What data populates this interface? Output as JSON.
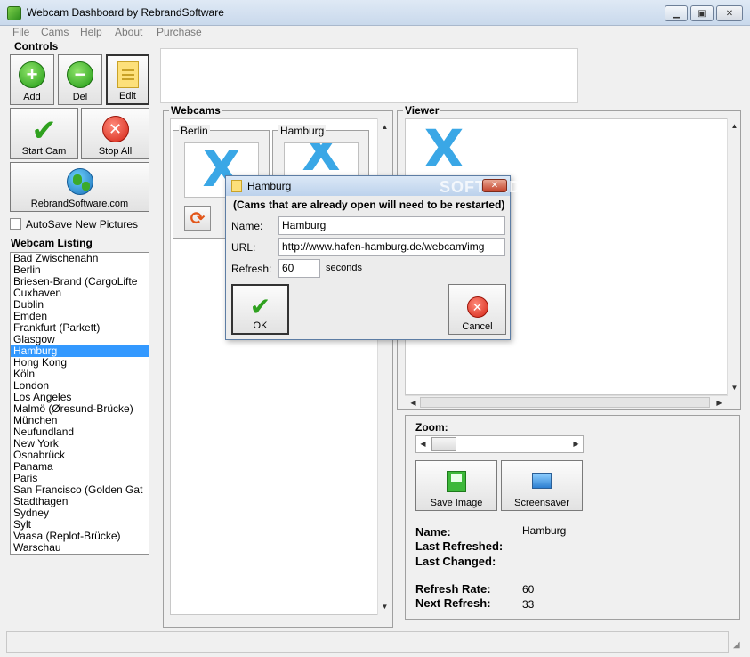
{
  "window": {
    "title": "Webcam Dashboard by RebrandSoftware",
    "minimize_icon": "minimize-icon",
    "maximize_icon": "maximize-icon",
    "close_icon": "close-icon"
  },
  "menu": [
    "File",
    "Cams",
    "Help",
    "About",
    "Purchase"
  ],
  "controls": {
    "title": "Controls",
    "add_label": "Add",
    "del_label": "Del",
    "edit_label": "Edit",
    "start_cam_label": "Start Cam",
    "stop_all_label": "Stop All",
    "website_label": "RebrandSoftware.com",
    "autosave_label": "AutoSave New Pictures",
    "autosave_checked": false
  },
  "listing": {
    "title": "Webcam Listing",
    "selected": "Hamburg",
    "items": [
      "Bad Zwischenahn",
      "Berlin",
      "Briesen-Brand (CargoLifte",
      "Cuxhaven",
      "Dublin",
      "Emden",
      "Frankfurt (Parkett)",
      "Glasgow",
      "Hamburg",
      "Hong Kong",
      "Köln",
      "London",
      "Los Angeles",
      "Malmö (Øresund-Brücke)",
      "München",
      "Neufundland",
      "New York",
      "Osnabrück",
      "Panama",
      "Paris",
      "San Francisco (Golden Gat",
      "Stadthagen",
      "Sydney",
      "Sylt",
      "Vaasa (Replot-Brücke)",
      "Warschau"
    ]
  },
  "webcams": {
    "title": "Webcams",
    "cams": [
      {
        "name": "Berlin"
      },
      {
        "name": "Hamburg"
      }
    ]
  },
  "viewer": {
    "title": "Viewer"
  },
  "info": {
    "zoom_label": "Zoom:",
    "save_image_label": "Save Image",
    "screensaver_label": "Screensaver",
    "name_label": "Name:",
    "name_value": "Hamburg",
    "last_refreshed_label": "Last Refreshed:",
    "last_changed_label": "Last Changed:",
    "refresh_rate_label": "Refresh Rate:",
    "refresh_rate_value": "60",
    "next_refresh_label": "Next Refresh:",
    "next_refresh_value": "33"
  },
  "dialog": {
    "title": "Hamburg",
    "notice": "(Cams that are already open will need to be restarted)",
    "name_label": "Name:",
    "name_value": "Hamburg",
    "url_label": "URL:",
    "url_value": "http://www.hafen-hamburg.de/webcam/img",
    "refresh_label": "Refresh:",
    "refresh_value": "60",
    "refresh_unit": "seconds",
    "ok_label": "OK",
    "cancel_label": "Cancel"
  },
  "watermark": "SOFTPEDIA"
}
